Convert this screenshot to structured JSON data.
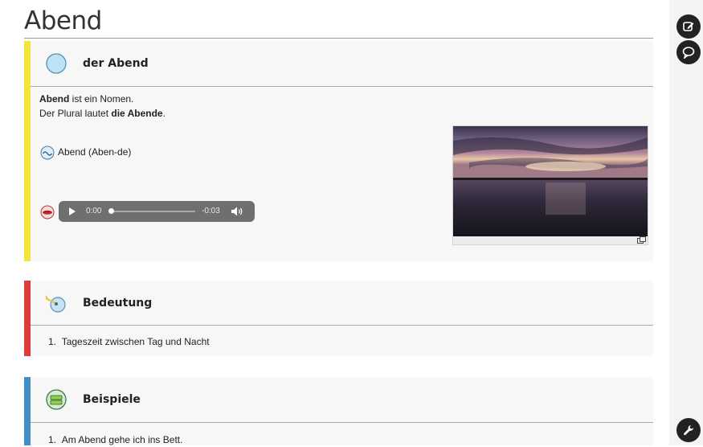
{
  "page": {
    "title": "Abend"
  },
  "rail": {
    "edit_icon": "edit-icon",
    "comment_icon": "comment-icon",
    "tools_icon": "wrench-icon"
  },
  "sections": [
    {
      "title": "der Abend",
      "icon": "circle-icon",
      "bar_color": "#f5e33a",
      "nomen_word": "Abend",
      "nomen_rest": " ist ein Nomen.",
      "plural_prefix": "Der Plural lautet ",
      "plural_word": "die Abende",
      "plural_suffix": ".",
      "syllables": "Abend (Aben-de)",
      "audio": {
        "current": "0:00",
        "remaining": "-0:03"
      }
    },
    {
      "title": "Bedeutung",
      "icon": "meaning-icon",
      "bar_color": "#e03b3b",
      "items": [
        {
          "num": "1.",
          "text": "Tageszeit zwischen Tag und Nacht"
        }
      ]
    },
    {
      "title": "Beispiele",
      "icon": "examples-icon",
      "bar_color": "#3f8fc9",
      "items": [
        {
          "num": "1.",
          "text": "Am Abend gehe ich ins Bett."
        }
      ]
    }
  ]
}
